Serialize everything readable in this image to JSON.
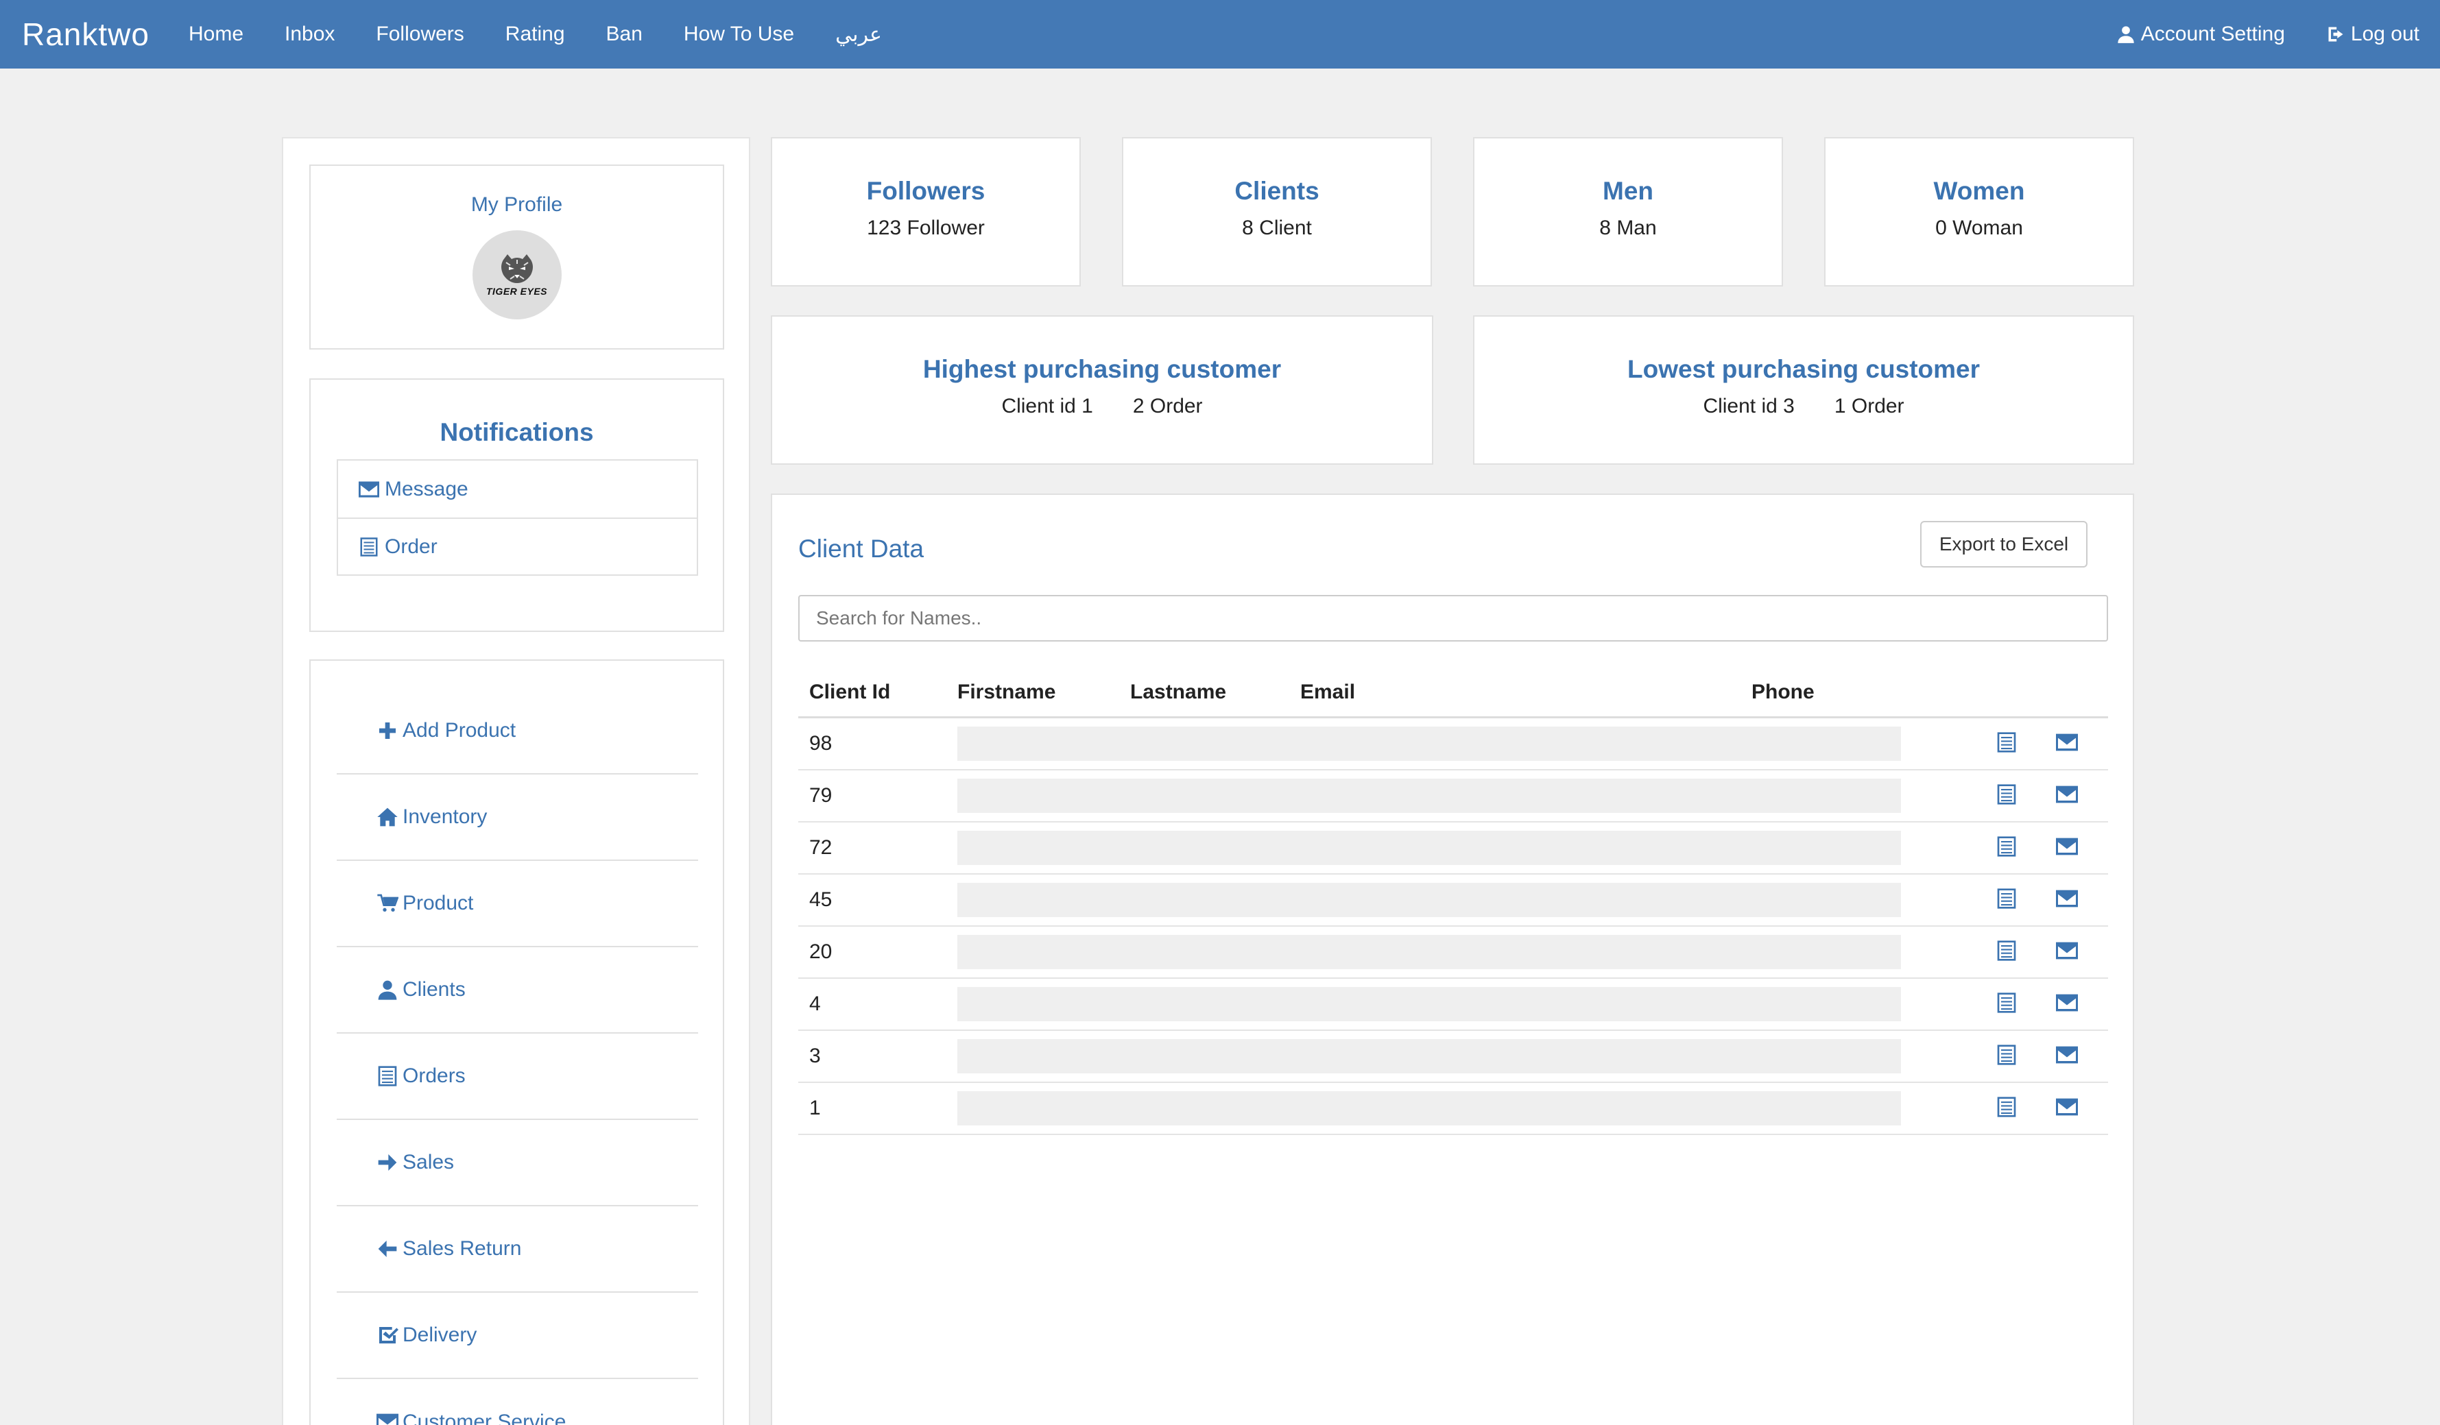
{
  "navbar": {
    "brand": "Ranktwo",
    "links": [
      "Home",
      "Inbox",
      "Followers",
      "Rating",
      "Ban",
      "How To Use",
      "عربي"
    ],
    "account": "Account Setting",
    "logout": "Log out"
  },
  "profile": {
    "title": "My Profile",
    "avatar_text": "TIGER EYES"
  },
  "notifications": {
    "title": "Notifications",
    "items": [
      {
        "label": "Message",
        "icon": "envelope-icon"
      },
      {
        "label": "Order",
        "icon": "list-icon"
      }
    ]
  },
  "menu": {
    "items": [
      {
        "label": "Add Product",
        "icon": "plus-icon"
      },
      {
        "label": "Inventory",
        "icon": "home-icon"
      },
      {
        "label": "Product",
        "icon": "cart-icon"
      },
      {
        "label": "Clients",
        "icon": "user-icon"
      },
      {
        "label": "Orders",
        "icon": "list-icon"
      },
      {
        "label": "Sales",
        "icon": "arrow-right-icon"
      },
      {
        "label": "Sales Return",
        "icon": "arrow-left-icon"
      },
      {
        "label": "Delivery",
        "icon": "check-icon"
      },
      {
        "label": "Customer Service",
        "icon": "envelope-icon"
      }
    ]
  },
  "stats": {
    "followers": {
      "title": "Followers",
      "value": "123 Follower"
    },
    "clients": {
      "title": "Clients",
      "value": "8 Client"
    },
    "men": {
      "title": "Men",
      "value": "8 Man"
    },
    "women": {
      "title": "Women",
      "value": "0 Woman"
    },
    "highest": {
      "title": "Highest purchasing customer",
      "client": "Client id 1",
      "orders": "2 Order"
    },
    "lowest": {
      "title": "Lowest purchasing customer",
      "client": "Client id 3",
      "orders": "1 Order"
    }
  },
  "client_data": {
    "title": "Client Data",
    "export_label": "Export to Excel",
    "search_placeholder": "Search for Names..",
    "columns": [
      "Client Id",
      "Firstname",
      "Lastname",
      "Email",
      "Phone"
    ],
    "rows": [
      "98",
      "79",
      "72",
      "45",
      "20",
      "4",
      "3",
      "1"
    ]
  },
  "colors": {
    "navbar": "#4479b5",
    "accent": "#3b73b0",
    "background": "#f0f0f0"
  }
}
